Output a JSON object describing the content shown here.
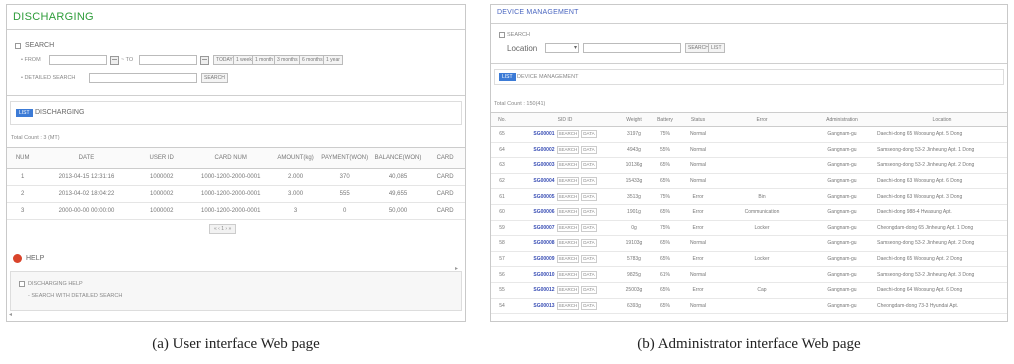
{
  "panel_a": {
    "title": "DISCHARGING",
    "search_label": "SEARCH",
    "from_label": "• FROM",
    "to_label": "~ TO",
    "period_buttons": [
      "TODAY",
      "1 week",
      "1 month",
      "3 months",
      "6 months",
      "1 year"
    ],
    "detailed_search_label": "• DETAILED SEARCH",
    "search_button": "SEARCH",
    "section_tag": "LIST",
    "section_label": "DISCHARGING",
    "total_count": "Total Count : 3 (MT)",
    "columns": [
      "NUM",
      "DATE",
      "USER ID",
      "CARD NUM",
      "AMOUNT(kg)",
      "PAYMENT(WON)",
      "BALANCE(WON)",
      "CARD"
    ],
    "rows": [
      [
        "1",
        "2013-04-15 12:31:16",
        "1000002",
        "1000-1200-2000-0001",
        "2.000",
        "370",
        "40,085",
        "CARD"
      ],
      [
        "2",
        "2013-04-02 18:04:22",
        "1000002",
        "1000-1200-2000-0001",
        "3.000",
        "555",
        "49,655",
        "CARD"
      ],
      [
        "3",
        "2000-00-00 00:00:00",
        "1000002",
        "1000-1200-2000-0001",
        "3",
        "0",
        "50,000",
        "CARD"
      ]
    ],
    "pager": "« ‹ 1 › »",
    "help_label": "HELP",
    "help_title": "DISCHARGING HELP",
    "help_text": "- SEARCH WITH DETAILED SEARCH"
  },
  "panel_b": {
    "title": "DEVICE MANAGEMENT",
    "search_label": "SEARCH",
    "location_label": "Location",
    "search_button": "SEARCH",
    "list_button": "LIST",
    "section_tag": "LIST",
    "section_label": "DEVICE MANAGEMENT",
    "total_count": "Total Count : 150(41)",
    "columns": [
      "No.",
      "SID ID",
      "Weight",
      "Battery",
      "Status",
      "Error",
      "Administration",
      "Location"
    ],
    "row_buttons": [
      "SEARCH",
      "DATA"
    ],
    "rows": [
      [
        "65",
        "SG00001",
        "3197g",
        "75%",
        "Normal",
        "",
        "Gangnam-gu",
        "Daechi-dong 65 Woosung Apt. 5 Dong"
      ],
      [
        "64",
        "SG00002",
        "4943g",
        "55%",
        "Normal",
        "",
        "Gangnam-gu",
        "Samseong-dong 53-2 Jinheung Apt. 1 Dong"
      ],
      [
        "63",
        "SG00003",
        "10136g",
        "65%",
        "Normal",
        "",
        "Gangnam-gu",
        "Samseong-dong 53-2 Jinheung Apt. 2 Dong"
      ],
      [
        "62",
        "SG00004",
        "15433g",
        "65%",
        "Normal",
        "",
        "Gangnam-gu",
        "Daechi-dong 63 Woosung Apt. 6 Dong"
      ],
      [
        "61",
        "SG00005",
        "3513g",
        "75%",
        "Error",
        "Bin",
        "Gangnam-gu",
        "Daechi-dong 63 Woosung Apt. 3 Dong"
      ],
      [
        "60",
        "SG00006",
        "1901g",
        "65%",
        "Error",
        "Communication",
        "Gangnam-gu",
        "Daechi-dong 988-4 Hwasung Apt."
      ],
      [
        "59",
        "SG00007",
        "0g",
        "75%",
        "Error",
        "Locker",
        "Gangnam-gu",
        "Cheongdam-dong 65 Jinheung Apt. 1 Dong"
      ],
      [
        "58",
        "SG00008",
        "19103g",
        "65%",
        "Normal",
        "",
        "Gangnam-gu",
        "Samseong-dong 53-2 Jinheung Apt. 2 Dong"
      ],
      [
        "57",
        "SG00009",
        "5783g",
        "65%",
        "Error",
        "Locker",
        "Gangnam-gu",
        "Daechi-dong 65 Woosung Apt. 2 Dong"
      ],
      [
        "56",
        "SG00010",
        "9825g",
        "61%",
        "Normal",
        "",
        "Gangnam-gu",
        "Samseong-dong 53-2 Jinheung Apt. 3 Dong"
      ],
      [
        "55",
        "SG00012",
        "25003g",
        "65%",
        "Error",
        "Cap",
        "Gangnam-gu",
        "Daechi-dong 64 Woosung Apt. 6 Dong"
      ],
      [
        "54",
        "SG00013",
        "6393g",
        "65%",
        "Normal",
        "",
        "Gangnam-gu",
        "Cheongdam-dong 73-3 Hyundai Apt."
      ]
    ]
  },
  "captions": {
    "a": "(a)  User interface Web page",
    "b": "(b)  Administrator interface Web page"
  }
}
